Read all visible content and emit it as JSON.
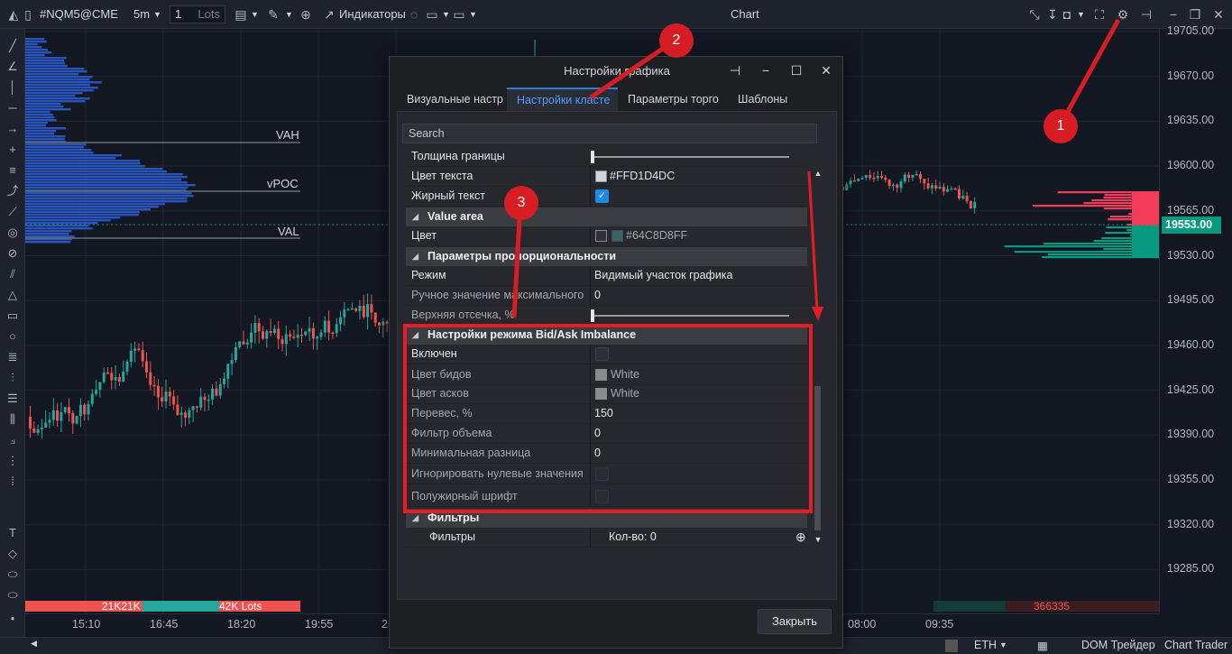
{
  "toolbar": {
    "symbol": "#NQM5@CME",
    "timeframe": "5m",
    "quantity": "1",
    "quantity_unit": "Lots",
    "indicators_label": "Индикаторы",
    "window_title": "Chart"
  },
  "price_axis": {
    "labels": [
      "19705.00",
      "19670.00",
      "19635.00",
      "19600.00",
      "19565.00",
      "19530.00",
      "19495.00",
      "19460.00",
      "19425.00",
      "19390.00",
      "19355.00",
      "19320.00",
      "19285.00"
    ],
    "current_price": "19553.00"
  },
  "time_axis": {
    "labels": [
      "15:10",
      "16:45",
      "18:20",
      "19:55",
      "2",
      "08:00",
      "09:35"
    ]
  },
  "chart": {
    "vah_label": "VAH",
    "vpoc_label": "vPOC",
    "val_label": "VAL",
    "volume_left_a": "21K21K",
    "volume_left_b": "42K Lots",
    "volume_right": "366335"
  },
  "statusbar": {
    "session": "ETH",
    "dom_trader": "DOM Трейдер",
    "chart_trader": "Chart Trader"
  },
  "dialog": {
    "title": "Настройки графика",
    "tabs": [
      "Визуальные настр",
      "Настройки класте",
      "Параметры торго",
      "Шаблоны"
    ],
    "active_tab": 1,
    "search_placeholder": "Search",
    "rows": {
      "border_thickness": "Толщина границы",
      "text_color": "Цвет текста",
      "text_color_value": "#FFD1D4DC",
      "bold_text": "Жирный текст",
      "value_area": "Value area",
      "color": "Цвет",
      "color_value": "#64C8D8FF",
      "proportion_params": "Параметры пропорциональности",
      "mode": "Режим",
      "mode_value": "Видимый участок графика",
      "manual_max": "Ручное значение максимального",
      "manual_max_value": "0",
      "upper_cutoff": "Верхняя отсечка, %",
      "imbalance_section": "Настройки режима Bid/Ask Imbalance",
      "enabled": "Включен",
      "bid_color": "Цвет бидов",
      "bid_color_value": "White",
      "ask_color": "Цвет асков",
      "ask_color_value": "White",
      "skew": "Перевес, %",
      "skew_value": "150",
      "volume_filter": "Фильтр объема",
      "volume_filter_value": "0",
      "min_diff": "Минимальная разница",
      "min_diff_value": "0",
      "ignore_zero": "Игнорировать нулевые значения",
      "bold_font": "Полужирный шрифт",
      "filters_section": "Фильтры",
      "filters": "Фильтры",
      "filters_value": "Кол-во: 0"
    },
    "close_label": "Закрыть"
  },
  "annotations": {
    "badge_1": "1",
    "badge_2": "2",
    "badge_3": "3"
  },
  "colors": {
    "bull": "#26a69a",
    "bear": "#ef5350",
    "accent": "#2a7fd4",
    "highlight": "#e51c23",
    "profile": "#2e5fd6"
  }
}
